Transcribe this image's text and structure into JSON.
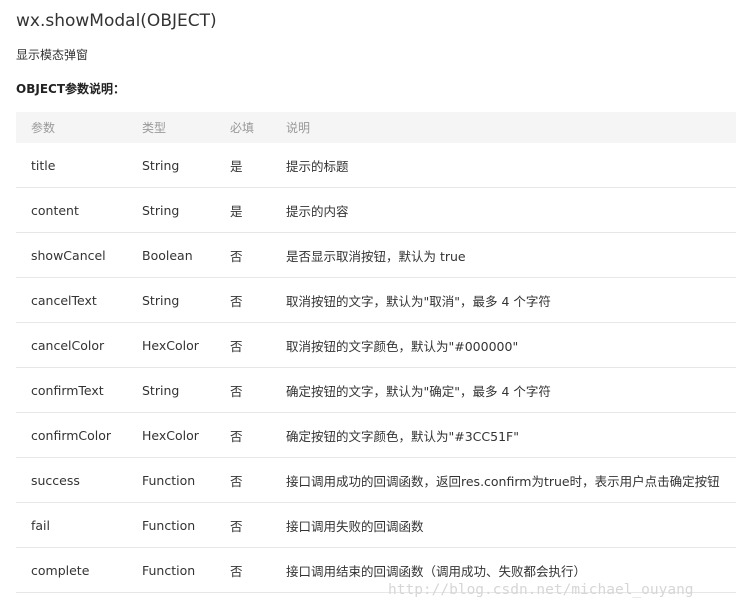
{
  "page": {
    "title": "wx.showModal(OBJECT)",
    "subtitle": "显示模态弹窗",
    "section_title": "OBJECT参数说明："
  },
  "table": {
    "headers": {
      "name": "参数",
      "type": "类型",
      "required": "必填",
      "description": "说明"
    },
    "rows": [
      {
        "name": "title",
        "type": "String",
        "required": "是",
        "description": "提示的标题"
      },
      {
        "name": "content",
        "type": "String",
        "required": "是",
        "description": "提示的内容"
      },
      {
        "name": "showCancel",
        "type": "Boolean",
        "required": "否",
        "description": "是否显示取消按钮，默认为 true"
      },
      {
        "name": "cancelText",
        "type": "String",
        "required": "否",
        "description": "取消按钮的文字，默认为\"取消\"，最多 4 个字符"
      },
      {
        "name": "cancelColor",
        "type": "HexColor",
        "required": "否",
        "description": "取消按钮的文字颜色，默认为\"#000000\""
      },
      {
        "name": "confirmText",
        "type": "String",
        "required": "否",
        "description": "确定按钮的文字，默认为\"确定\"，最多 4 个字符"
      },
      {
        "name": "confirmColor",
        "type": "HexColor",
        "required": "否",
        "description": "确定按钮的文字颜色，默认为\"#3CC51F\""
      },
      {
        "name": "success",
        "type": "Function",
        "required": "否",
        "description": "接口调用成功的回调函数，返回res.confirm为true时，表示用户点击确定按钮"
      },
      {
        "name": "fail",
        "type": "Function",
        "required": "否",
        "description": "接口调用失败的回调函数"
      },
      {
        "name": "complete",
        "type": "Function",
        "required": "否",
        "description": "接口调用结束的回调函数（调用成功、失败都会执行）"
      }
    ]
  },
  "watermark": "http://blog.csdn.net/michael_ouyang",
  "colors": {
    "text": "#333333",
    "header_text": "#999999",
    "header_bg": "#f5f5f5",
    "row_border": "#e7e7e7",
    "watermark": "#d6d6d6"
  }
}
